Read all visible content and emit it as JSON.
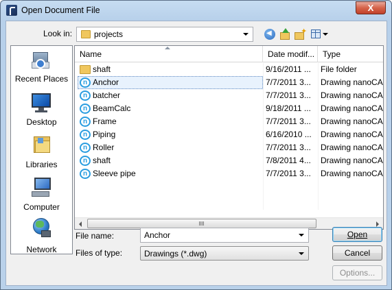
{
  "window": {
    "title": "Open Document File",
    "close_glyph": "X"
  },
  "toolbar": {
    "look_in_label": "Look in:",
    "look_in_value": "projects"
  },
  "places": [
    {
      "label": "Recent Places",
      "icon": "recent-places-icon"
    },
    {
      "label": "Desktop",
      "icon": "desktop-icon"
    },
    {
      "label": "Libraries",
      "icon": "libraries-icon"
    },
    {
      "label": "Computer",
      "icon": "computer-icon"
    },
    {
      "label": "Network",
      "icon": "network-icon"
    }
  ],
  "list": {
    "columns": [
      "Name",
      "Date modif...",
      "Type"
    ],
    "rows": [
      {
        "name": "shaft",
        "date": "9/16/2011 ...",
        "type": "File folder",
        "icon": "folder-icon"
      },
      {
        "name": "Anchor",
        "date": "7/7/2011 3...",
        "type": "Drawing nanoCA...",
        "icon": "nanocad-drawing-icon",
        "selected": true
      },
      {
        "name": "batcher",
        "date": "7/7/2011 3...",
        "type": "Drawing nanoCA...",
        "icon": "nanocad-drawing-icon"
      },
      {
        "name": "BeamCalc",
        "date": "9/18/2011 ...",
        "type": "Drawing nanoCA...",
        "icon": "nanocad-drawing-icon"
      },
      {
        "name": "Frame",
        "date": "7/7/2011 3...",
        "type": "Drawing nanoCA...",
        "icon": "nanocad-drawing-icon"
      },
      {
        "name": "Piping",
        "date": "6/16/2010 ...",
        "type": "Drawing nanoCA...",
        "icon": "nanocad-drawing-icon"
      },
      {
        "name": "Roller",
        "date": "7/7/2011 3...",
        "type": "Drawing nanoCA...",
        "icon": "nanocad-drawing-icon"
      },
      {
        "name": "shaft",
        "date": "7/8/2011 4...",
        "type": "Drawing nanoCA...",
        "icon": "nanocad-drawing-icon"
      },
      {
        "name": "Sleeve pipe",
        "date": "7/7/2011 3...",
        "type": "Drawing nanoCA...",
        "icon": "nanocad-drawing-icon"
      }
    ]
  },
  "form": {
    "file_name_label": "File name:",
    "file_name_value": "Anchor",
    "file_type_label": "Files of type:",
    "file_type_value": "Drawings (*.dwg)"
  },
  "buttons": {
    "open": "Open",
    "cancel": "Cancel",
    "options": "Options..."
  },
  "colors": {
    "selection": "#e8f2fd",
    "accent": "#2a9de0",
    "folder": "#f0c75e"
  }
}
